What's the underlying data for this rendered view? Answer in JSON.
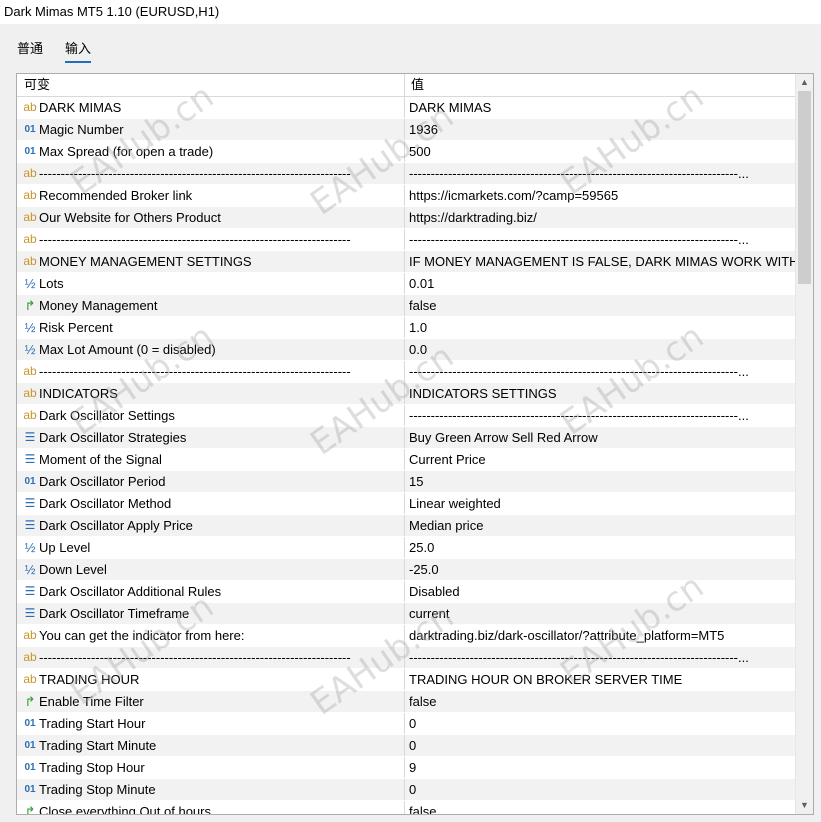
{
  "window": {
    "title": "Dark Mimas MT5 1.10 (EURUSD,H1)"
  },
  "tabs": [
    {
      "label": "普通"
    },
    {
      "label": "输入"
    }
  ],
  "table": {
    "headers": {
      "name": "可变",
      "value": "值"
    },
    "rows": [
      {
        "icon": "ab",
        "name": "DARK MIMAS",
        "value": "DARK MIMAS"
      },
      {
        "icon": "01",
        "name": "Magic Number",
        "value": "1936"
      },
      {
        "icon": "01",
        "name": "Max Spread (for open a trade)",
        "value": "500"
      },
      {
        "icon": "ab",
        "name": "------------------------------------------------------------------------",
        "value": "----------------------------------------------------------------------------..."
      },
      {
        "icon": "ab",
        "name": "Recommended Broker link",
        "value": "https://icmarkets.com/?camp=59565"
      },
      {
        "icon": "ab",
        "name": "Our Website for Others Product",
        "value": "https://darktrading.biz/"
      },
      {
        "icon": "ab",
        "name": "------------------------------------------------------------------------",
        "value": "----------------------------------------------------------------------------..."
      },
      {
        "icon": "ab",
        "name": "MONEY MANAGEMENT SETTINGS",
        "value": "IF MONEY MANAGEMENT IS FALSE, DARK MIMAS WORK WITH..."
      },
      {
        "icon": "½",
        "name": "Lots",
        "value": "0.01"
      },
      {
        "icon": "bool",
        "name": "Money Management",
        "value": "false"
      },
      {
        "icon": "½",
        "name": "Risk Percent",
        "value": "1.0"
      },
      {
        "icon": "½",
        "name": "Max Lot Amount (0 = disabled)",
        "value": "0.0"
      },
      {
        "icon": "ab",
        "name": "------------------------------------------------------------------------",
        "value": "----------------------------------------------------------------------------..."
      },
      {
        "icon": "ab",
        "name": "INDICATORS",
        "value": "INDICATORS SETTINGS"
      },
      {
        "icon": "ab",
        "name": "Dark Oscillator Settings",
        "value": "----------------------------------------------------------------------------..."
      },
      {
        "icon": "enum",
        "name": "Dark Oscillator Strategies",
        "value": "Buy Green Arrow Sell Red Arrow"
      },
      {
        "icon": "enum",
        "name": "Moment of the Signal",
        "value": "Current Price"
      },
      {
        "icon": "01",
        "name": "Dark Oscillator Period",
        "value": "15"
      },
      {
        "icon": "enum",
        "name": "Dark Oscillator Method",
        "value": "Linear weighted"
      },
      {
        "icon": "enum",
        "name": "Dark Oscillator Apply Price",
        "value": "Median price"
      },
      {
        "icon": "½",
        "name": "Up Level",
        "value": "25.0"
      },
      {
        "icon": "½",
        "name": "Down Level",
        "value": "-25.0"
      },
      {
        "icon": "enum",
        "name": "Dark Oscillator Additional Rules",
        "value": "Disabled"
      },
      {
        "icon": "enum",
        "name": "Dark Oscillator Timeframe",
        "value": "current"
      },
      {
        "icon": "ab",
        "name": "You can get the indicator from here:",
        "value": "darktrading.biz/dark-oscillator/?attribute_platform=MT5"
      },
      {
        "icon": "ab",
        "name": "------------------------------------------------------------------------",
        "value": "----------------------------------------------------------------------------..."
      },
      {
        "icon": "ab",
        "name": "TRADING HOUR",
        "value": "TRADING HOUR ON BROKER SERVER TIME"
      },
      {
        "icon": "bool",
        "name": "Enable Time Filter",
        "value": "false"
      },
      {
        "icon": "01",
        "name": "Trading Start Hour",
        "value": "0"
      },
      {
        "icon": "01",
        "name": "Trading Start Minute",
        "value": "0"
      },
      {
        "icon": "01",
        "name": "Trading Stop Hour",
        "value": "9"
      },
      {
        "icon": "01",
        "name": "Trading Stop Minute",
        "value": "0"
      },
      {
        "icon": "bool",
        "name": "Close everything Out of hours",
        "value": "false"
      },
      {
        "icon": "ab",
        "name": "------------------------------------------------------------------------",
        "value": ""
      }
    ]
  },
  "watermark": "EAHub.cn"
}
